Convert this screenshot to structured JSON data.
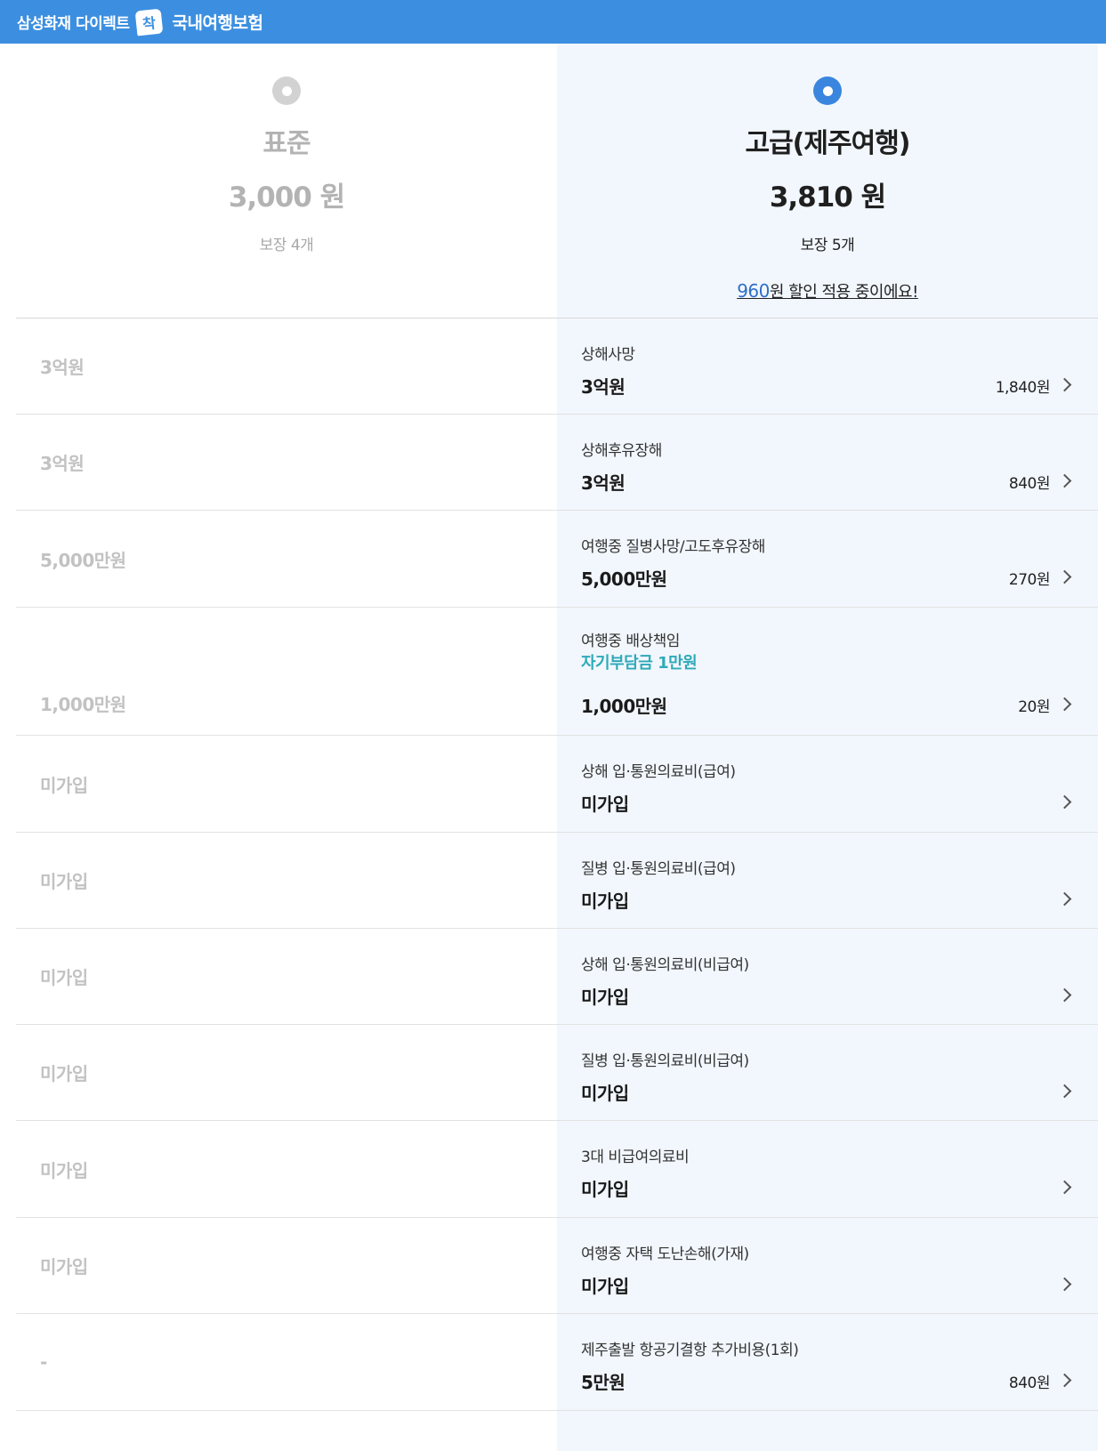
{
  "header": {
    "brand": "삼성화재 다이렉트",
    "logo_glyph": "착",
    "product": "국내여행보험",
    "bg_color": "#3c8fe0"
  },
  "plans": [
    {
      "name": "표준",
      "price": "3,000 원",
      "coverage_count": "보장 4개",
      "selected": false
    },
    {
      "name": "고급(제주여행)",
      "price": "3,810 원",
      "coverage_count": "보장 5개",
      "selected": true,
      "discount_amount": "960",
      "discount_text": "원 할인 적용 중이에요!"
    }
  ],
  "coverages": [
    {
      "name": "상해사망",
      "standard": "3억원",
      "premium_amount": "3억원",
      "premium_price": "1,840원"
    },
    {
      "name": "상해후유장해",
      "standard": "3억원",
      "premium_amount": "3억원",
      "premium_price": "840원"
    },
    {
      "name": "여행중 질병사망/고도후유장해",
      "standard": "5,000만원",
      "premium_amount": "5,000만원",
      "premium_price": "270원"
    },
    {
      "name": "여행중 배상책임",
      "note": "자기부담금 1만원",
      "standard": "1,000만원",
      "premium_amount": "1,000만원",
      "premium_price": "20원"
    },
    {
      "name": "상해 입·통원의료비(급여)",
      "standard": "미가입",
      "premium_amount": "미가입",
      "premium_price": ""
    },
    {
      "name": "질병 입·통원의료비(급여)",
      "standard": "미가입",
      "premium_amount": "미가입",
      "premium_price": ""
    },
    {
      "name": "상해 입·통원의료비(비급여)",
      "standard": "미가입",
      "premium_amount": "미가입",
      "premium_price": ""
    },
    {
      "name": "질병 입·통원의료비(비급여)",
      "standard": "미가입",
      "premium_amount": "미가입",
      "premium_price": ""
    },
    {
      "name": "3대 비급여의료비",
      "standard": "미가입",
      "premium_amount": "미가입",
      "premium_price": ""
    },
    {
      "name": "여행중 자택 도난손해(가재)",
      "standard": "미가입",
      "premium_amount": "미가입",
      "premium_price": ""
    },
    {
      "name": "제주출발 항공기결항 추가비용(1회)",
      "standard": "-",
      "premium_amount": "5만원",
      "premium_price": "840원"
    }
  ]
}
